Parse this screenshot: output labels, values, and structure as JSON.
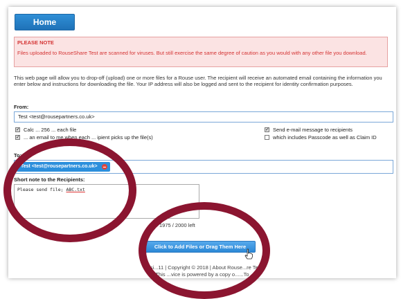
{
  "nav": {
    "home_label": "Home"
  },
  "notice": {
    "heading": "PLEASE NOTE",
    "body": "Files uploaded to RouseShare Test are scanned for viruses. But still exercise the same degree of caution as you would with any other file you download."
  },
  "intro": "This web page will allow you to drop-off (upload) one or more files for a Rouse user. The recipient will receive an automated email containing the information you enter below and instructions for downloading the file. Your IP address will also be logged and sent to the recipient for identity confirmation purposes.",
  "from": {
    "label": "From:",
    "value": "Test  <test@rousepartners.co.uk>"
  },
  "options": {
    "calc": {
      "label": "Calc  ... 256  ...  each file",
      "checked": true
    },
    "email_me": {
      "label": "... an email to me when each ... ipient picks up the file(s)",
      "checked": true
    },
    "send_email": {
      "label": "Send e-mail message to recipients",
      "checked": true
    },
    "passcode": {
      "label": "which includes Passcode as well as Claim ID",
      "checked": false
    }
  },
  "to": {
    "label": "To:",
    "recipient": "Test <test@rousepartners.co.uk>"
  },
  "note": {
    "label": "Short note to the Recipients:",
    "text_prefix": "Please send file; ",
    "filename": "ABC.txt",
    "counter": "1975 / 2000 left"
  },
  "upload": {
    "label": "Click to Add Files or Drag Them Here"
  },
  "footer": {
    "line1_a": "Versi...11 | Copyright © 2018 | ",
    "line1_link": "About Rouse...re Test",
    "line2_a": "This ...vice is powered by a copy o...",
    "line2_link": "...To"
  },
  "colors": {
    "accent": "#2c8fdc",
    "notice_text": "#d43333",
    "notice_bg": "#fbe3e3",
    "annotation_ring": "#8b1530"
  },
  "icons": {
    "remove": "remove-recipient-icon",
    "cursor": "hand-pointer-icon"
  }
}
